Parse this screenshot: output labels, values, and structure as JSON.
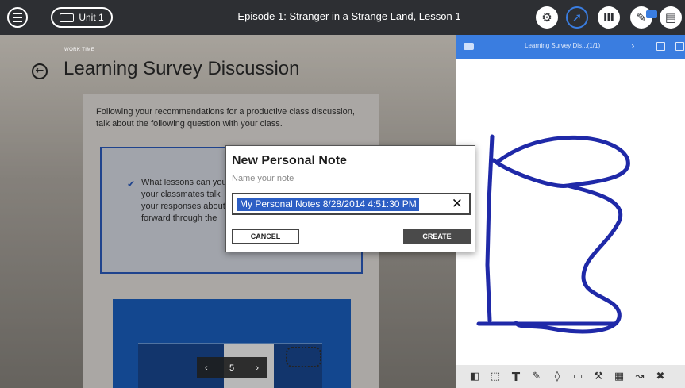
{
  "topbar": {
    "unit_label": "Unit 1",
    "episode_title": "Episode 1: Stranger in a Strange Land, Lesson 1",
    "icons": [
      "tools-icon",
      "compass-icon",
      "library-icon",
      "notes-icon",
      "clipboard-icon"
    ]
  },
  "page": {
    "section_label": "WORK TIME",
    "title": "Learning Survey Discussion",
    "intro": "Following your recommendations for a productive class discussion, talk about the following question with your class.",
    "question_partial": "What lessons can you your classmates talk your responses about forward through the"
  },
  "pager": {
    "prev": "‹",
    "page": "5",
    "next": "›"
  },
  "notes_panel": {
    "title": "Learning Survey Dis...(1/1)",
    "accent_color": "#3a7de0",
    "ink_color": "#1f29a8"
  },
  "dialog": {
    "title": "New Personal Note",
    "subtitle": "Name your note",
    "input_value": "My Personal Notes 8/28/2014 4:51:30 PM",
    "clear_glyph": "✕",
    "cancel_label": "CANCEL",
    "create_label": "CREATE"
  }
}
